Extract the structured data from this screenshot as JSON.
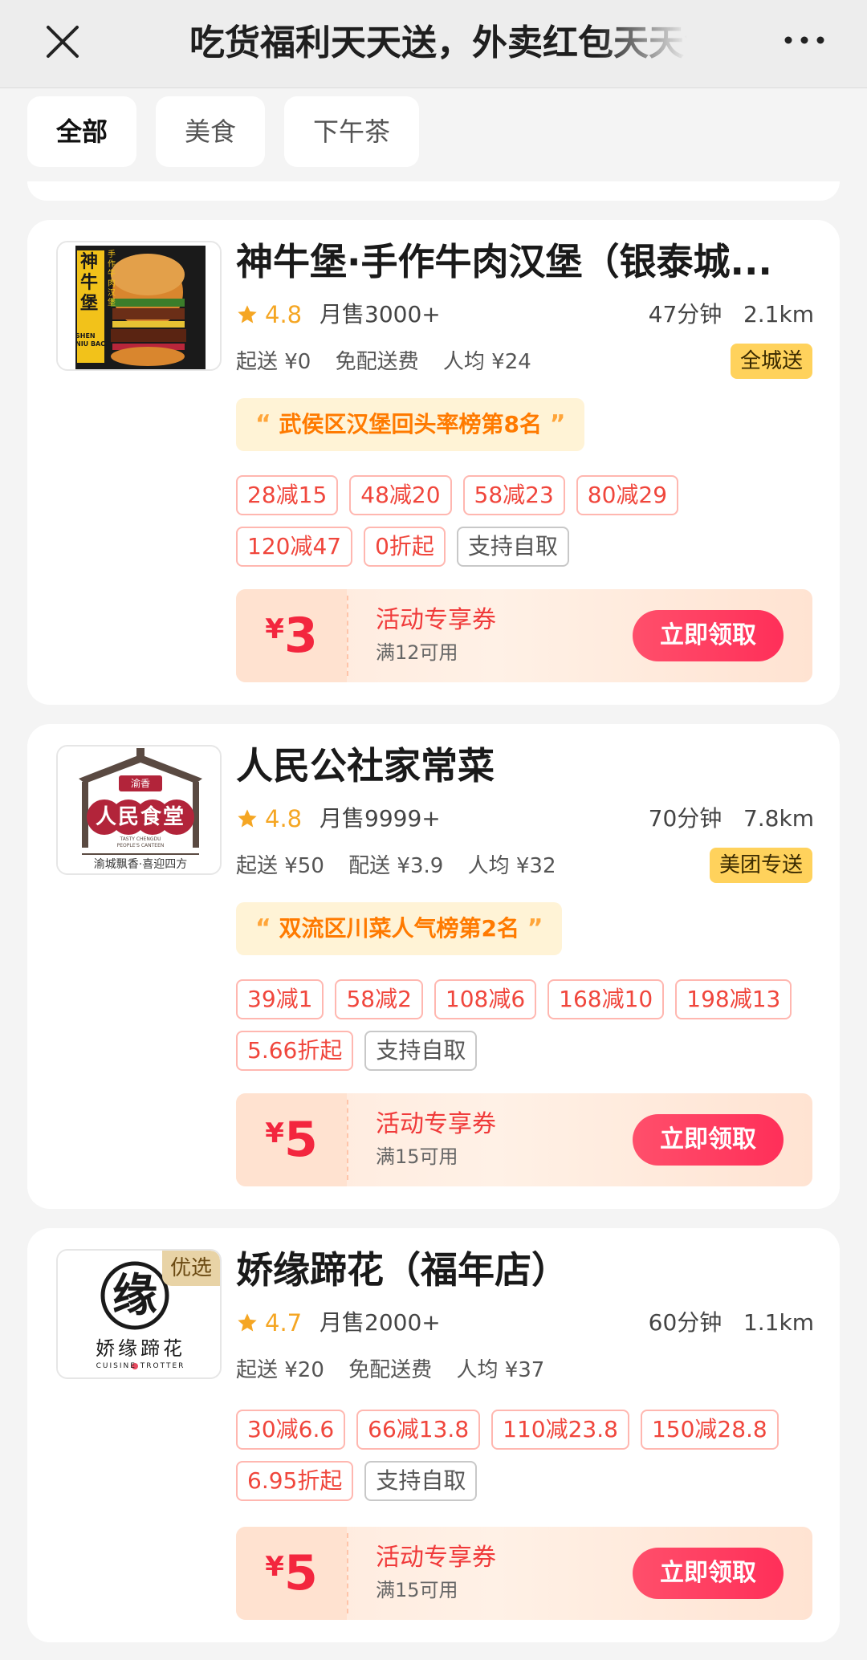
{
  "header": {
    "title": "吃货福利天天送，外卖红包天天领"
  },
  "tabs": [
    {
      "label": "全部"
    },
    {
      "label": "美食"
    },
    {
      "label": "下午茶"
    }
  ],
  "colors": {
    "accent": "#f3263e",
    "rank_text": "#ff7a00",
    "rating": "#f5a623",
    "badge_bg": "#ffd25c"
  },
  "stores": [
    {
      "name": "神牛堡·手作牛肉汉堡（银泰城...",
      "logo_text": "神牛堡",
      "logo_sub": "SHEN NIU BAO",
      "logo_side": "手作牛肉汉堡",
      "rating": "4.8",
      "sales": "月售3000+",
      "eta": "47分钟",
      "distance": "2.1km",
      "min_order": "起送 ¥0",
      "delivery_fee": "免配送费",
      "avg_price": "人均 ¥24",
      "delivery_badge": "全城送",
      "rank_text": "武侯区汉堡回头率榜第8名",
      "promo_tags": [
        "28减15",
        "48减20",
        "58减23",
        "80减29",
        "120减47",
        "0折起"
      ],
      "pickup_tag": "支持自取",
      "coupon": {
        "yen": "¥",
        "amount": "3",
        "title": "活动专享券",
        "condition": "满12可用",
        "button": "立即领取"
      }
    },
    {
      "name": "人民公社家常菜",
      "logo_text": "人民食堂",
      "logo_top": "渝香",
      "logo_sub": "TASTY CHENGDU PEOPLE'S CANTEEN",
      "logo_bottom": "渝城飘香·喜迎四方",
      "rating": "4.8",
      "sales": "月售9999+",
      "eta": "70分钟",
      "distance": "7.8km",
      "min_order": "起送 ¥50",
      "delivery_fee": "配送 ¥3.9",
      "avg_price": "人均 ¥32",
      "delivery_badge": "美团专送",
      "rank_text": "双流区川菜人气榜第2名",
      "promo_tags": [
        "39减1",
        "58减2",
        "108减6",
        "168减10",
        "198减13",
        "5.66折起"
      ],
      "pickup_tag": "支持自取",
      "coupon": {
        "yen": "¥",
        "amount": "5",
        "title": "活动专享券",
        "condition": "满15可用",
        "button": "立即领取"
      }
    },
    {
      "name": "娇缘蹄花（福年店）",
      "logo_text": "娇缘蹄花",
      "logo_char": "缘",
      "logo_sub": "CUISINE TROTTER",
      "premium_badge": "优选",
      "rating": "4.7",
      "sales": "月售2000+",
      "eta": "60分钟",
      "distance": "1.1km",
      "min_order": "起送 ¥20",
      "delivery_fee": "免配送费",
      "avg_price": "人均 ¥37",
      "promo_tags": [
        "30减6.6",
        "66减13.8",
        "110减23.8",
        "150减28.8",
        "6.95折起"
      ],
      "pickup_tag": "支持自取",
      "coupon": {
        "yen": "¥",
        "amount": "5",
        "title": "活动专享券",
        "condition": "满15可用",
        "button": "立即领取"
      }
    }
  ]
}
